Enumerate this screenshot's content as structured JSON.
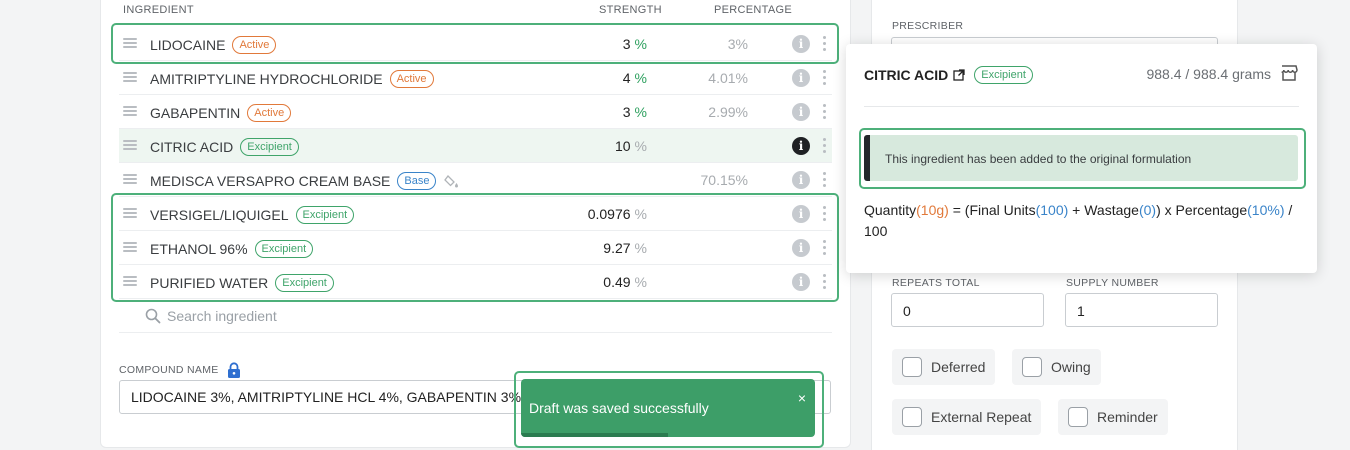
{
  "table": {
    "headers": {
      "ingredient": "INGREDIENT",
      "strength": "STRENGTH",
      "percentage": "PERCENTAGE"
    },
    "rows": [
      {
        "name": "LIDOCAINE",
        "badge": "Active",
        "strength": "3",
        "unit": "%",
        "percentage": "3%"
      },
      {
        "name": "AMITRIPTYLINE HYDROCHLORIDE",
        "badge": "Active",
        "strength": "4",
        "unit": "%",
        "percentage": "4.01%"
      },
      {
        "name": "GABAPENTIN",
        "badge": "Active",
        "strength": "3",
        "unit": "%",
        "percentage": "2.99%"
      },
      {
        "name": "CITRIC ACID",
        "badge": "Excipient",
        "strength": "10",
        "unit": "%",
        "percentage": ""
      },
      {
        "name": "MEDISCA VERSAPRO CREAM BASE",
        "badge": "Base",
        "strength": "",
        "unit": "",
        "percentage": "70.15%"
      },
      {
        "name": "VERSIGEL/LIQUIGEL",
        "badge": "Excipient",
        "strength": "0.0976",
        "unit": "%",
        "percentage": ""
      },
      {
        "name": "ETHANOL 96%",
        "badge": "Excipient",
        "strength": "9.27",
        "unit": "%",
        "percentage": ""
      },
      {
        "name": "PURIFIED WATER",
        "badge": "Excipient",
        "strength": "0.49",
        "unit": "%",
        "percentage": ""
      }
    ],
    "search_placeholder": "Search ingredient"
  },
  "compound": {
    "label": "COMPOUND NAME",
    "value": "LIDOCAINE 3%, AMITRIPTYLINE HCL 4%, GABAPENTIN 3% CREAM"
  },
  "toast": {
    "message": "Draft was saved successfully",
    "close": "×",
    "progress": 0.5
  },
  "right": {
    "prescriber_label": "PRESCRIBER",
    "repeats_label": "REPEATS TOTAL",
    "repeats_value": "0",
    "supply_label": "SUPPLY NUMBER",
    "supply_value": "1",
    "checkboxes": [
      "Deferred",
      "Owing",
      "External Repeat",
      "Reminder"
    ]
  },
  "popover": {
    "title": "CITRIC ACID",
    "badge": "Excipient",
    "quantity": "988.4 / 988.4 grams",
    "notice": "This ingredient has been added to the original formulation",
    "formula": {
      "q_label": "Quantity",
      "q_value": "(10g)",
      "eq": " = (Final Units",
      "units": "(100)",
      "plus": " + Wastage",
      "wastage": "(0)",
      "times": ") x Percentage",
      "percentage": "(10%)",
      "divide": " / 100"
    }
  },
  "colors": {
    "accent_green": "#4db07a",
    "active_orange": "#e1793a",
    "base_blue": "#3a84c9",
    "toast_green": "#3d9e68"
  }
}
